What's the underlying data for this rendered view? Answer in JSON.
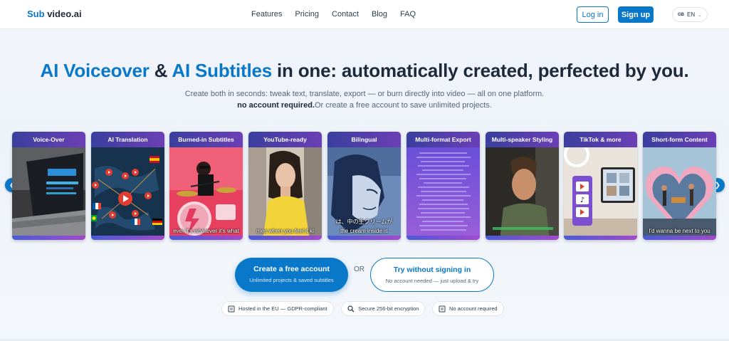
{
  "header": {
    "logo_sub": "Sub",
    "logo_rest": "video.ai",
    "nav": [
      "Features",
      "Pricing",
      "Contact",
      "Blog",
      "FAQ"
    ],
    "login": "Log in",
    "signup": "Sign up",
    "lang_flag": "GB",
    "lang_code": "EN"
  },
  "hero": {
    "title_accent1": "AI Voiceover",
    "title_amp": " & ",
    "title_accent2": "AI Subtitles",
    "title_rest": " in one: automatically created, perfected by you.",
    "sub1": "Create both in seconds: tweak text, translate, export — or burn directly into video — all on one platform.",
    "sub2_bold": "no account required.",
    "sub2_rest": "Or create a free account to save unlimited projects."
  },
  "carousel": {
    "cards": [
      {
        "title": "Voice-Over",
        "caption": ""
      },
      {
        "title": "AI Translation",
        "caption": ""
      },
      {
        "title": "Burned-in Subtitles",
        "caption": "ever it's whatever it's what"
      },
      {
        "title": "YouTube-ready",
        "caption": "mes when you feel it ki"
      },
      {
        "title": "Bilingual",
        "caption": "the cream inside is"
      },
      {
        "title": "Multi-format Export",
        "caption": ""
      },
      {
        "title": "Multi-speaker Styling",
        "caption": ""
      },
      {
        "title": "TikTok & more",
        "caption": ""
      },
      {
        "title": "Short-form Content",
        "caption": "I'd wanna be next to you"
      }
    ],
    "bilingual_jp": "は、中の生クリームが"
  },
  "cta": {
    "primary_main": "Create a free account",
    "primary_small": "Unlimited projects & saved subtitles",
    "or": "OR",
    "secondary_main": "Try without signing in",
    "secondary_small": "No account needed — just upload & try"
  },
  "badges": [
    "Hosted in the EU — GDPR-compliant",
    "Secure 256-bit encryption",
    "No account required"
  ],
  "colors": {
    "accent": "#0a78c8"
  }
}
